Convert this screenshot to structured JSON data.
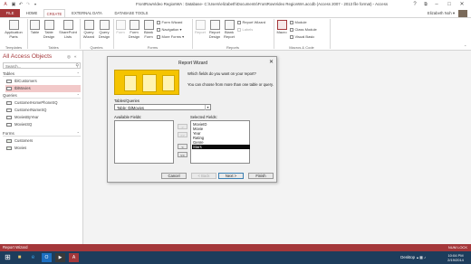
{
  "window": {
    "title": "FrontRowVideo RegionWA : Database- C:\\Users\\elizabeth\\Documents\\FrontRowVideo RegionWA.accdb (Access 2007 - 2013 file format) - Access",
    "min": "–",
    "max": "□",
    "close": "✕",
    "help": "?",
    "restore_ribbon": "⧉"
  },
  "ribbon_tabs": {
    "file": "FILE",
    "home": "HOME",
    "create": "CREATE",
    "external": "EXTERNAL DATA",
    "tools": "DATABASE TOOLS"
  },
  "user": {
    "name": "Elizabeth Noh",
    "dropdown": "▾"
  },
  "ribbon": {
    "app_parts": "Application Parts",
    "table": "Table",
    "table_design": "Table Design",
    "sharepoint_lists": "SharePoint Lists",
    "query_wizard": "Query Wizard",
    "query_design": "Query Design",
    "form": "Form",
    "form_design": "Form Design",
    "blank_form": "Blank Form",
    "form_wizard": "Form Wizard",
    "navigation": "Navigation",
    "more_forms": "More Forms",
    "report": "Report",
    "report_design": "Report Design",
    "blank_report": "Blank Report",
    "report_wizard": "Report Wizard",
    "labels": "Labels",
    "macro": "Macro",
    "module": "Module",
    "class_module": "Class Module",
    "visual_basic": "Visual Basic",
    "groups": {
      "templates": "Templates",
      "tables": "Tables",
      "queries": "Queries",
      "forms": "Forms",
      "reports": "Reports",
      "macros": "Macros & Code"
    }
  },
  "nav": {
    "title": "All Access Objects",
    "search_placeholder": "Search...",
    "sections": [
      {
        "label": "Tables",
        "items": [
          "tblCustomers",
          "tblMovies"
        ]
      },
      {
        "label": "Queries",
        "items": [
          "CustomerHomePhoneSQ",
          "CustomerNameSQ",
          "MoviesByYear",
          "MoviesSQ"
        ]
      },
      {
        "label": "Forms",
        "items": [
          "Customers",
          "Movies"
        ]
      }
    ],
    "selected": "tblMovies"
  },
  "dialog": {
    "title": "Report Wizard",
    "close": "✕",
    "question": "Which fields do you want on your report?",
    "hint": "You can choose from more than one table or query.",
    "tables_label": "Tables/Queries",
    "table_value": "Table: tblMovies",
    "available_label": "Available Fields:",
    "selected_label": "Selected Fields:",
    "selected_fields": [
      "MovieID",
      "Movie",
      "Year",
      "Rating",
      "Genre",
      "Stars"
    ],
    "highlighted_field": "Stars",
    "move_one": ">",
    "move_all": ">>",
    "remove_one": "<",
    "remove_all": "<<",
    "cancel": "Cancel",
    "back": "< Back",
    "next": "Next >",
    "finish": "Finish"
  },
  "status": {
    "left": "Report Wizard",
    "right": "NUM LOCK"
  },
  "taskbar": {
    "desktop": "Desktop",
    "time": "10:04 PM",
    "date": "2/19/2014"
  },
  "colors": {
    "accent": "#a4373a",
    "taskbar": "#1d3d5c",
    "wizard_art": "#f5c400"
  }
}
